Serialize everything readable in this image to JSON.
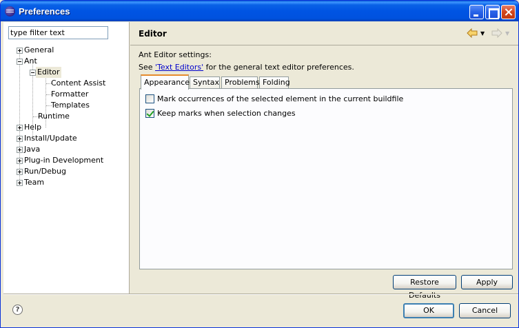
{
  "window": {
    "title": "Preferences"
  },
  "filter": {
    "value": "type filter text"
  },
  "tree": {
    "items": [
      {
        "label": "General"
      },
      {
        "label": "Ant"
      },
      {
        "label": "Editor"
      },
      {
        "label": "Content Assist"
      },
      {
        "label": "Formatter"
      },
      {
        "label": "Templates"
      },
      {
        "label": "Runtime"
      },
      {
        "label": "Help"
      },
      {
        "label": "Install/Update"
      },
      {
        "label": "Java"
      },
      {
        "label": "Plug-in Development"
      },
      {
        "label": "Run/Debug"
      },
      {
        "label": "Team"
      }
    ]
  },
  "page": {
    "title": "Editor",
    "settings_label": "Ant Editor settings:",
    "see_prefix": "See ",
    "see_link": "'Text Editors'",
    "see_suffix": " for the general text editor preferences."
  },
  "tabs": [
    {
      "label": "Appearance"
    },
    {
      "label": "Syntax"
    },
    {
      "label": "Problems"
    },
    {
      "label": "Folding"
    }
  ],
  "options": [
    {
      "label": "Mark occurrences of the selected element in the current buildfile",
      "checked": false
    },
    {
      "label": "Keep marks when selection changes",
      "checked": true
    }
  ],
  "buttons": {
    "restore_defaults": "Restore Defaults",
    "apply": "Apply",
    "ok": "OK",
    "cancel": "Cancel"
  },
  "help": {
    "glyph": "?"
  },
  "colors": {
    "titlebar": "#0054e3",
    "active_tab_accent": "#e68b2c",
    "link": "#0000cc",
    "checkmark": "#21a121"
  }
}
